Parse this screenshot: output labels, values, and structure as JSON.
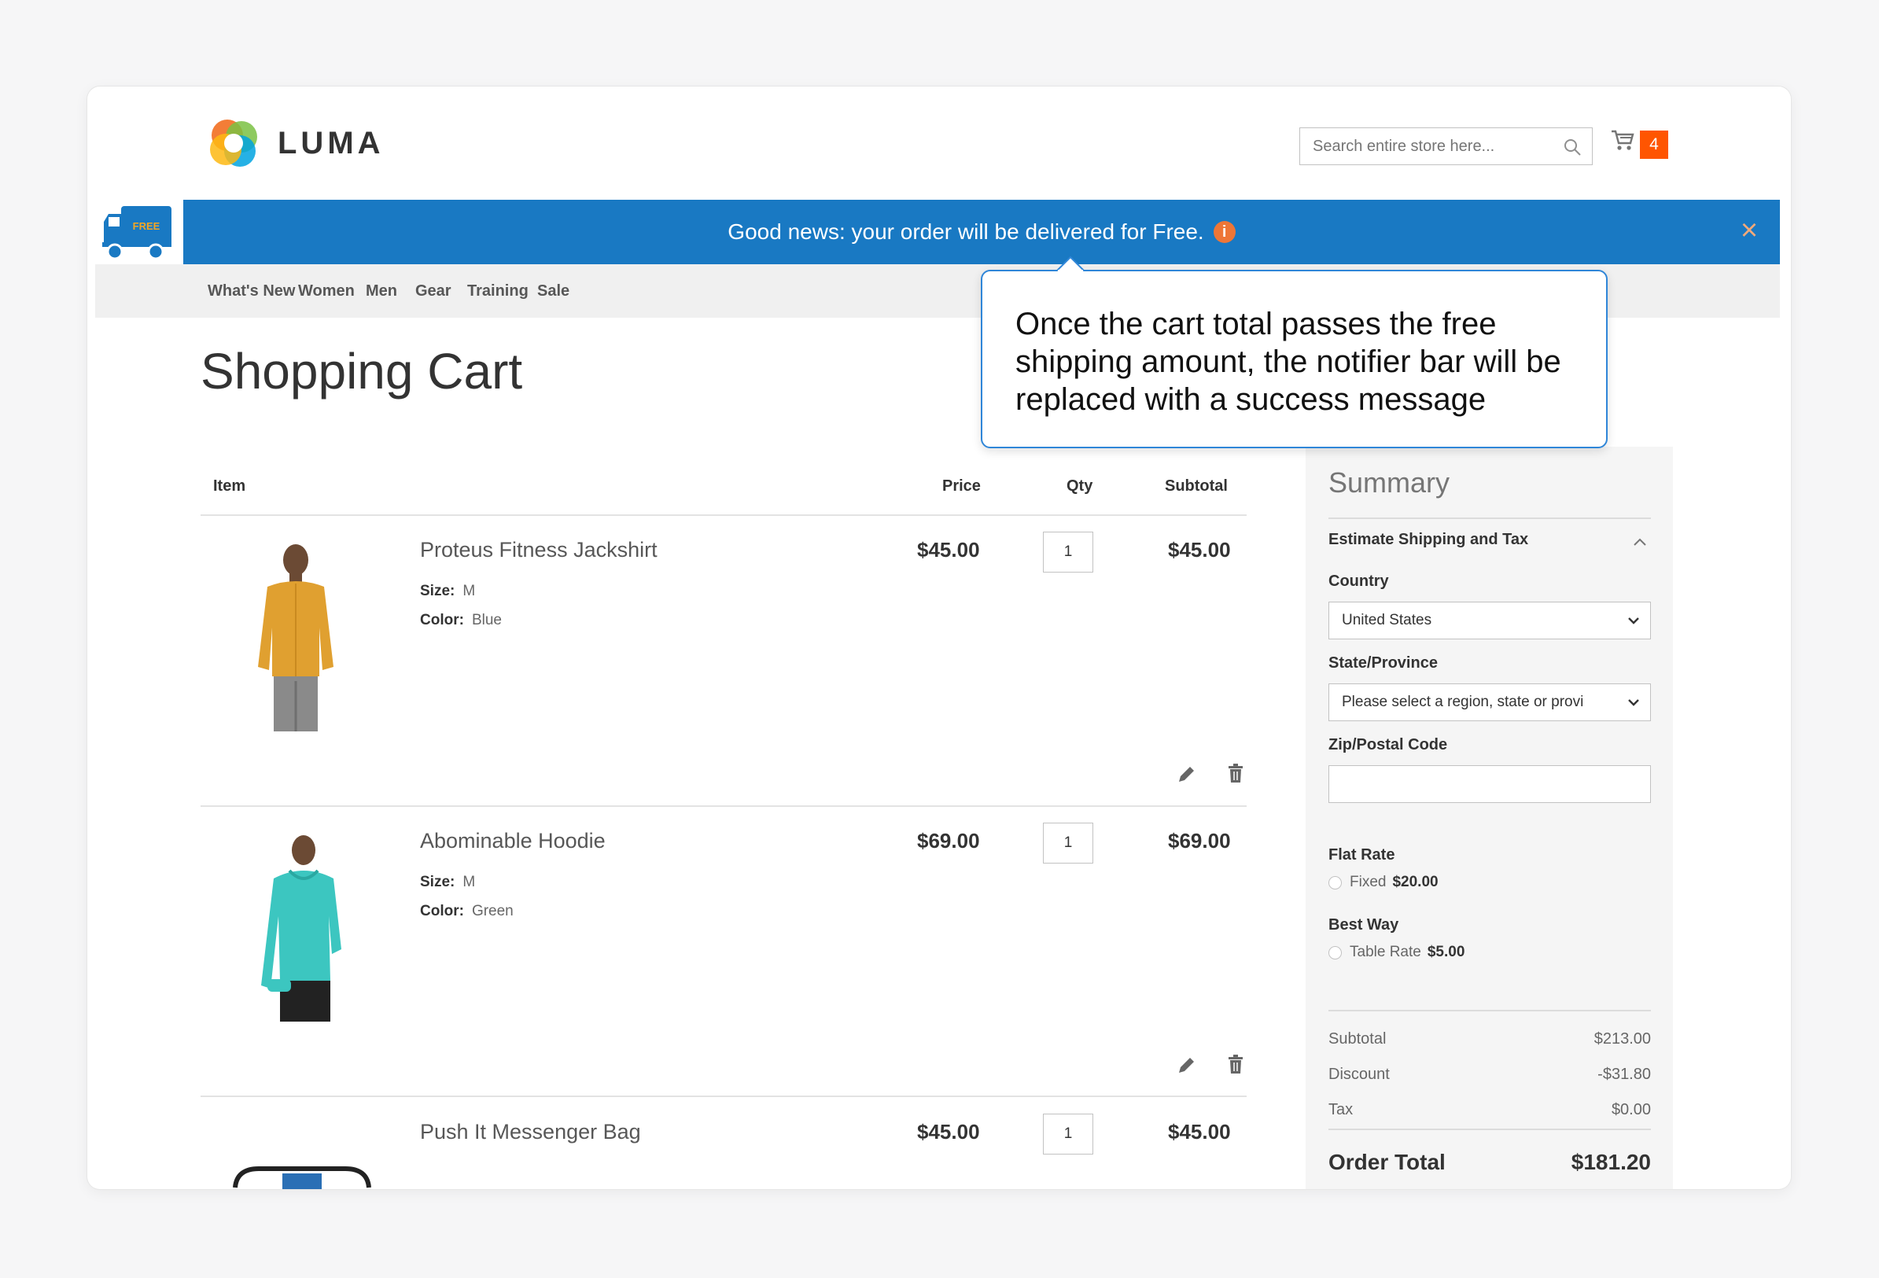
{
  "header": {
    "logo_text": "LUMA",
    "search_placeholder": "Search entire store here...",
    "cart_count": "4"
  },
  "notifier": {
    "truck_label": "FREE",
    "message": "Good news: your order will be delivered for Free.",
    "info_icon": "i",
    "close_icon": "×"
  },
  "nav": {
    "items": [
      "What's New",
      "Women",
      "Men",
      "Gear",
      "Training",
      "Sale"
    ]
  },
  "page": {
    "title": "Shopping Cart"
  },
  "cart_table": {
    "headers": {
      "item": "Item",
      "price": "Price",
      "qty": "Qty",
      "subtotal": "Subtotal"
    },
    "rows": [
      {
        "name": "Proteus Fitness Jackshirt",
        "size_label": "Size:",
        "size": "M",
        "color_label": "Color:",
        "color": "Blue",
        "price": "$45.00",
        "qty": "1",
        "subtotal": "$45.00"
      },
      {
        "name": "Abominable Hoodie",
        "size_label": "Size:",
        "size": "M",
        "color_label": "Color:",
        "color": "Green",
        "price": "$69.00",
        "qty": "1",
        "subtotal": "$69.00"
      },
      {
        "name": "Push It Messenger Bag",
        "price": "$45.00",
        "qty": "1",
        "subtotal": "$45.00"
      }
    ]
  },
  "summary": {
    "title": "Summary",
    "estimate_label": "Estimate Shipping and Tax",
    "country_label": "Country",
    "country_value": "United States",
    "state_label": "State/Province",
    "state_value": "Please select a region, state or provi",
    "zip_label": "Zip/Postal Code",
    "flat_rate_label": "Flat Rate",
    "flat_rate_option": "Fixed",
    "flat_rate_price": "$20.00",
    "best_way_label": "Best Way",
    "best_way_option": "Table Rate",
    "best_way_price": "$5.00",
    "subtotal_label": "Subtotal",
    "subtotal_value": "$213.00",
    "discount_label": "Discount",
    "discount_value": "-$31.80",
    "tax_label": "Tax",
    "tax_value": "$0.00",
    "order_total_label": "Order Total",
    "order_total_value": "$181.20"
  },
  "callout": {
    "text": "Once the cart total passes the free shipping amount, the notifier bar will be replaced with a success message"
  },
  "colors": {
    "notifier_blue": "#1979c3",
    "cart_badge": "#ff5501",
    "callout_border": "#2f86d8",
    "info_orange": "#ee7637"
  }
}
